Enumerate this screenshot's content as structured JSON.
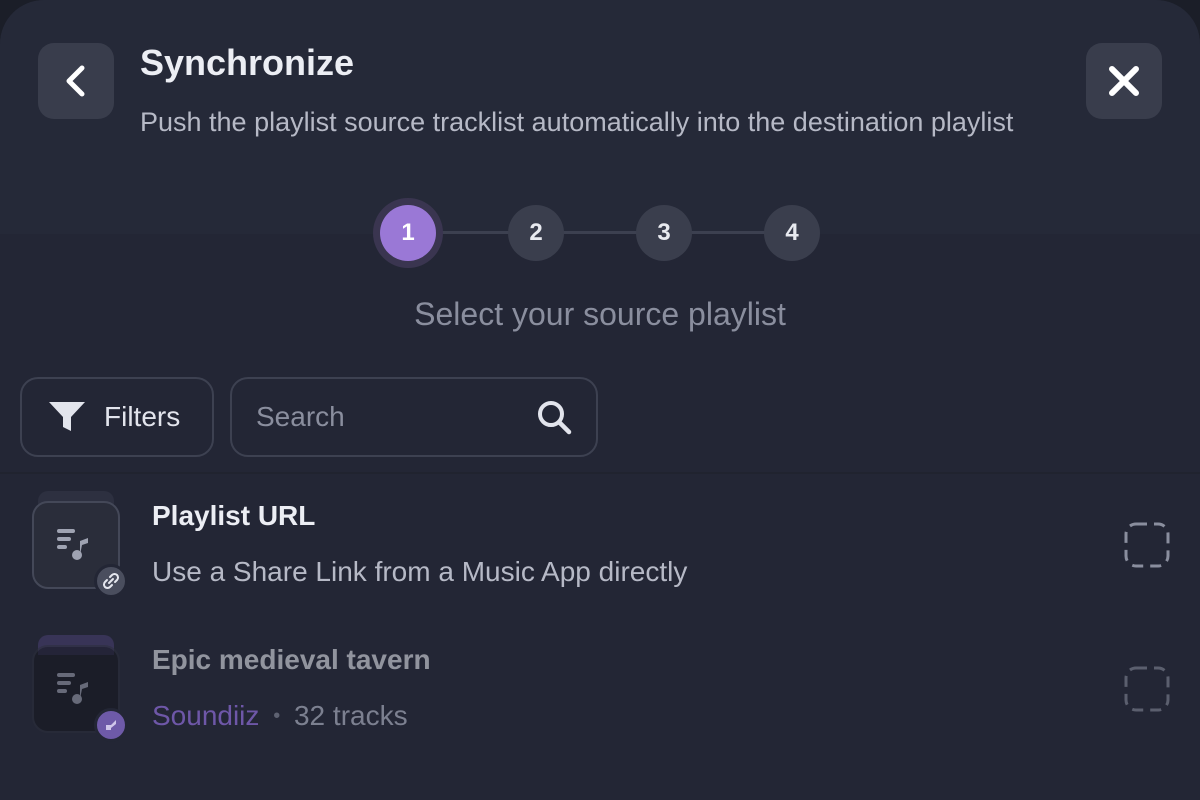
{
  "header": {
    "title": "Synchronize",
    "subtitle": "Push the playlist source tracklist automatically into the destination playlist"
  },
  "stepper": {
    "steps": [
      "1",
      "2",
      "3",
      "4"
    ],
    "active_step": 1,
    "caption": "Select your source playlist"
  },
  "toolbar": {
    "filters_label": "Filters",
    "search_placeholder": "Search"
  },
  "playlists": [
    {
      "title": "Playlist URL",
      "subtitle": "Use a Share Link from a Music App directly",
      "badge_icon": "link-icon"
    },
    {
      "title": "Epic medieval tavern",
      "source": "Soundiiz",
      "separator": "•",
      "tracks": "32 tracks",
      "badge_icon": "soundiiz-icon"
    }
  ],
  "colors": {
    "accent": "#9a78d6",
    "source_accent": "#7b5fc4",
    "background": "#232635"
  }
}
